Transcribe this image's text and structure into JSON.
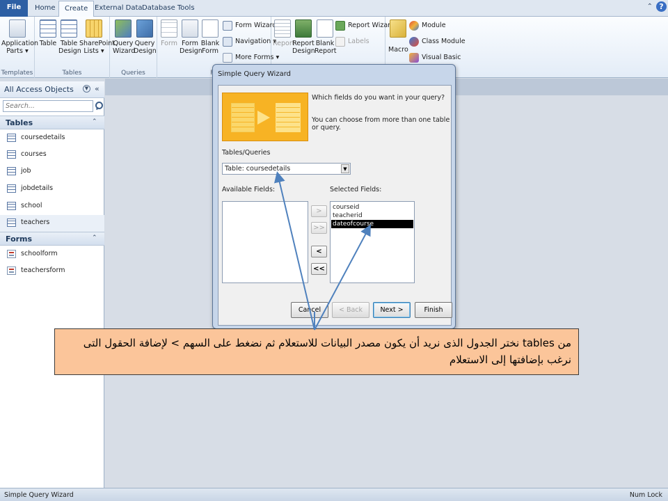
{
  "ribbon": {
    "tabs": [
      "File",
      "Home",
      "Create",
      "External Data",
      "Database Tools"
    ],
    "active_tab": "Create",
    "groups": {
      "templates": {
        "label": "Templates",
        "buttons": [
          {
            "line1": "Application",
            "line2": "Parts ▾",
            "icon": "app-parts-icon"
          }
        ]
      },
      "tables": {
        "label": "Tables",
        "buttons": [
          {
            "line1": "Table",
            "line2": "",
            "icon": "table-icon"
          },
          {
            "line1": "Table",
            "line2": "Design",
            "icon": "table-design-icon"
          },
          {
            "line1": "SharePoint",
            "line2": "Lists ▾",
            "icon": "sharepoint-lists-icon"
          }
        ]
      },
      "queries": {
        "label": "Queries",
        "buttons": [
          {
            "line1": "Query",
            "line2": "Wizard",
            "icon": "query-wizard-icon"
          },
          {
            "line1": "Query",
            "line2": "Design",
            "icon": "query-design-icon"
          }
        ]
      },
      "forms": {
        "label": "Fo",
        "buttons": [
          {
            "line1": "Form",
            "line2": "",
            "icon": "form-icon"
          },
          {
            "line1": "Form",
            "line2": "Design",
            "icon": "form-design-icon"
          },
          {
            "line1": "Blank",
            "line2": "Form",
            "icon": "blank-form-icon"
          }
        ],
        "small": [
          "Form Wizard",
          "Navigation ▾",
          "More Forms ▾"
        ]
      },
      "reports": {
        "buttons": [
          {
            "line1": "Report",
            "line2": "",
            "icon": "report-icon"
          },
          {
            "line1": "Report",
            "line2": "Design",
            "icon": "report-design-icon"
          },
          {
            "line1": "Blank",
            "line2": "Report",
            "icon": "blank-report-icon"
          }
        ],
        "small": [
          "Report Wizard",
          "Labels"
        ]
      },
      "macros": {
        "buttons": [
          {
            "line1": "Macro",
            "line2": "",
            "icon": "macro-icon"
          }
        ],
        "small": [
          "Module",
          "Class Module",
          "Visual Basic"
        ]
      }
    }
  },
  "nav": {
    "title": "All Access Objects",
    "search_placeholder": "Search...",
    "sections": [
      {
        "name": "Tables",
        "items": [
          "coursedetails",
          "courses",
          "job",
          "jobdetails",
          "school",
          "teachers"
        ]
      },
      {
        "name": "Forms",
        "items": [
          "schoolform",
          "teachersform"
        ]
      }
    ]
  },
  "dialog": {
    "title": "Simple Query Wizard",
    "question": "Which fields do you want in your query?",
    "hint": "You can choose from more than one table or query.",
    "tables_label": "Tables/Queries",
    "tables_value": "Table: coursedetails",
    "available_label": "Available Fields:",
    "selected_label": "Selected Fields:",
    "available_fields": [],
    "selected_fields": [
      "courseid",
      "teacherid",
      "dateofcourse"
    ],
    "highlighted_field": "dateofcourse",
    "move_buttons": [
      ">",
      ">>",
      "<",
      "<<"
    ],
    "buttons": {
      "cancel": "Cancel",
      "back": "< Back",
      "next": "Next >",
      "finish": "Finish"
    }
  },
  "callout": {
    "text": "من  tables نختر الجدول الذى نريد أن يكون مصدر البيانات للاستعلام ثم نضغط على السهم > لإضافة الحقول  التى نرغب بإضافتها إلى الاستعلام"
  },
  "status": {
    "left": "Simple Query Wizard",
    "right": "Num Lock"
  },
  "colors": {
    "file_tab": "#2d5fa4",
    "callout_bg": "#fbc59a",
    "arrow": "#4f81bd",
    "highlight": "#000000"
  }
}
